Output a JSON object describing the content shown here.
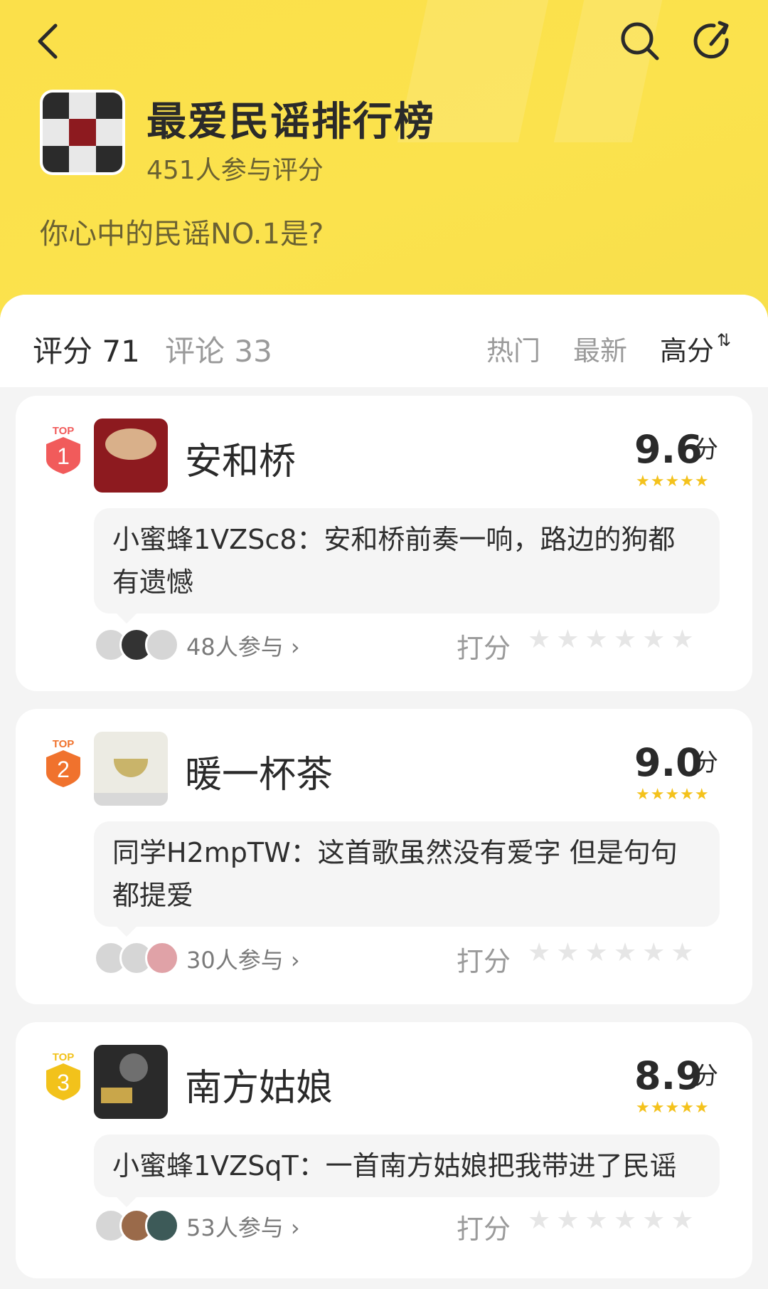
{
  "header": {
    "title": "最爱民谣排行榜",
    "participants": "451人参与评分",
    "question": "你心中的民谣NO.1是?",
    "icons": [
      "back-icon",
      "search-icon",
      "share-icon"
    ]
  },
  "tabs": {
    "rating": "评分 71",
    "comment": "评论 33"
  },
  "sort": {
    "hot": "热门",
    "new": "最新",
    "high": "高分",
    "high_arrow": "⇅"
  },
  "items": [
    {
      "rank": "1",
      "badge": "TOP",
      "song": "安和桥",
      "score": "9.6",
      "score_unit": "分",
      "stars": "★★★★★",
      "comment": "小蜜蜂1VZSc8：安和桥前奏一响，路边的狗都有遗憾",
      "participants": "48人参与",
      "rate_label": "打分",
      "rate_stars": "★★★★★★",
      "colors": {
        "badge": "#f15b5b"
      }
    },
    {
      "rank": "2",
      "badge": "TOP",
      "song": "暖一杯茶",
      "score": "9.0",
      "score_unit": "分",
      "stars": "★★★★★",
      "comment": "同学H2mpTW：这首歌虽然没有爱字 但是句句都提爱",
      "participants": "30人参与",
      "rate_label": "打分",
      "rate_stars": "★★★★★★",
      "colors": {
        "badge": "#f0722d"
      }
    },
    {
      "rank": "3",
      "badge": "TOP",
      "song": "南方姑娘",
      "score": "8.9",
      "score_unit": "分",
      "stars": "★★★★★",
      "comment": "小蜜蜂1VZSqT：一首南方姑娘把我带进了民谣",
      "participants": "53人参与",
      "rate_label": "打分",
      "rate_stars": "★★★★★★",
      "colors": {
        "badge": "#f2c21b"
      }
    }
  ],
  "chevron": "›"
}
